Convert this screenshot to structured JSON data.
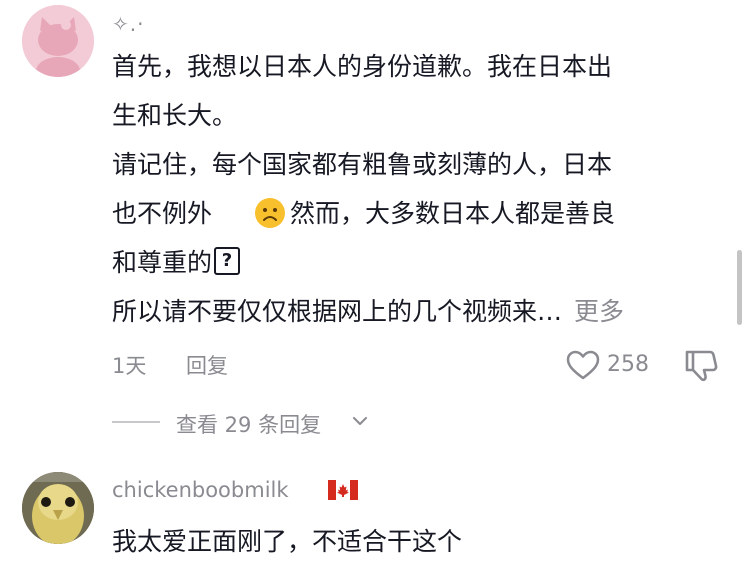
{
  "comment1": {
    "username": "✧.·",
    "lines": [
      "首先，我想以日本人的身份道歉。我在日本出",
      "生和长大。",
      "请记住，每个国家都有粗鲁或刻薄的人，日本",
      "也不例外",
      "然而，大多数日本人都是善良",
      "和尊重的",
      "所以请不要仅仅根据网上的几个视频来…"
    ],
    "unknown_glyph": "?",
    "more_label": "更多",
    "time": "1天",
    "reply_label": "回复",
    "likes": "258",
    "view_replies": "查看 29 条回复",
    "avatar_icon": "hello-kitty-avatar",
    "emoji_icon": "frowning-face-emoji"
  },
  "comment2": {
    "username": "chickenboobmilk",
    "flag_icon": "canada-flag-icon",
    "text": "我太爱正面刚了，不适合干这个",
    "avatar_icon": "bird-avatar"
  },
  "colors": {
    "text": "#161823",
    "muted": "#8a8b91",
    "avatar1_bg": "#f3cbd6"
  }
}
